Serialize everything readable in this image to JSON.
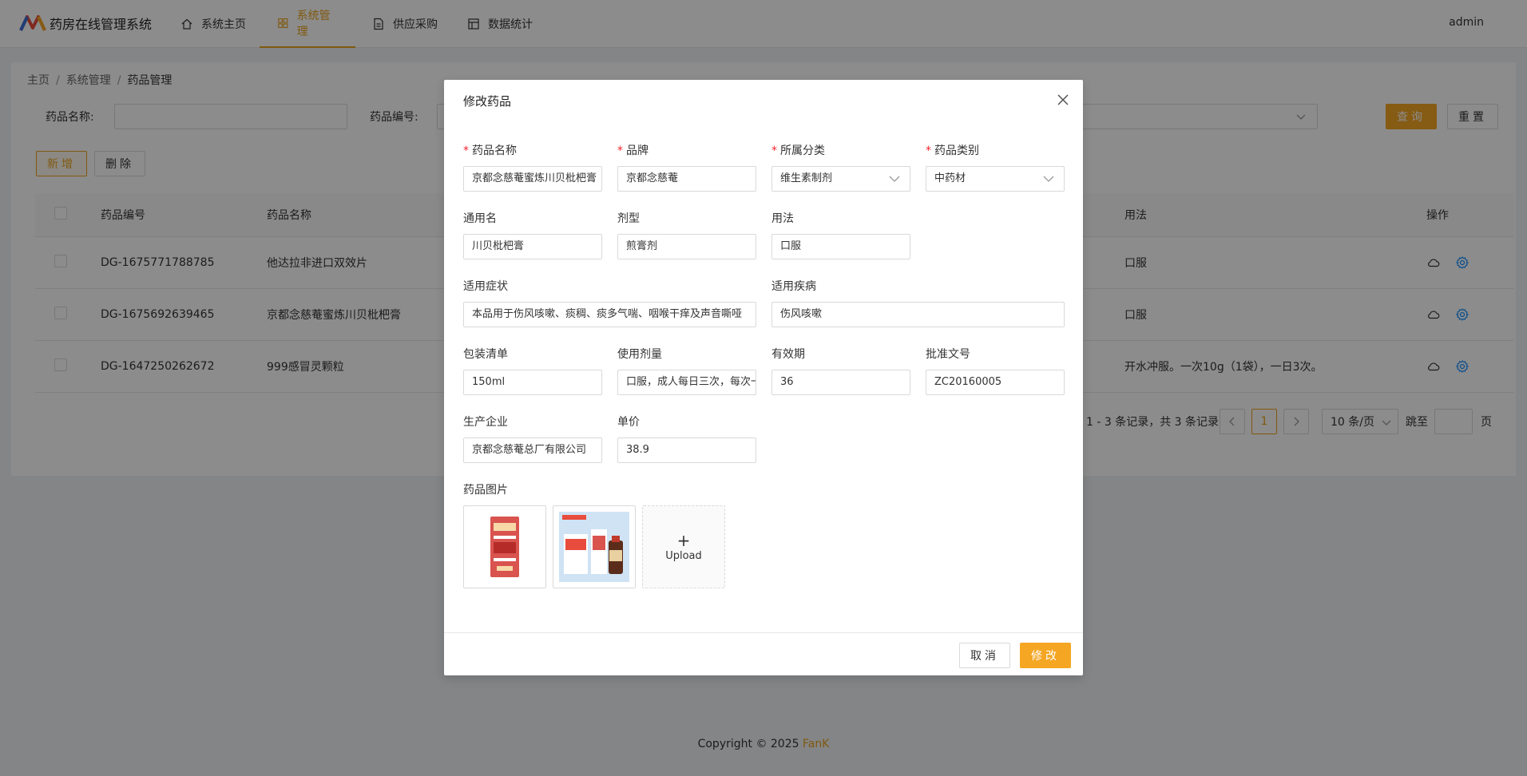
{
  "app": {
    "title": "药房在线管理系统",
    "user": "admin"
  },
  "nav": {
    "items": [
      {
        "label": "系统主页",
        "icon": "home-icon"
      },
      {
        "label": "系统管理",
        "icon": "grid-icon"
      },
      {
        "label": "供应采购",
        "icon": "document-icon"
      },
      {
        "label": "数据统计",
        "icon": "table-icon"
      }
    ],
    "active_index": 1
  },
  "breadcrumb": [
    "主页",
    "系统管理",
    "药品管理"
  ],
  "search": {
    "name_label": "药品名称:",
    "number_label": "药品编号:",
    "query_button": "查询",
    "reset_button": "重置"
  },
  "toolbar": {
    "add_button": "新增",
    "delete_button": "删除"
  },
  "table": {
    "columns": [
      "药品编号",
      "药品名称",
      "用法",
      "操作"
    ],
    "rows": [
      {
        "number": "DG-1675771788785",
        "name": "他达拉非进口双效片",
        "usage": "口服"
      },
      {
        "number": "DG-1675692639465",
        "name": "京都念慈菴蜜炼川贝枇杷膏",
        "usage": "口服"
      },
      {
        "number": "DG-1647250262672",
        "name": "999感冒灵颗粒",
        "usage": "开水冲服。一次10g（1袋），一日3次。"
      }
    ]
  },
  "pagination": {
    "summary": "1 - 3 条记录，共 3 条记录",
    "current_page": "1",
    "page_size": "10 条/页",
    "jump_label": "跳至",
    "page_unit": "页"
  },
  "footer": {
    "copyright_prefix": "Copyright © 2025 ",
    "brand": "FanK"
  },
  "modal": {
    "title": "修改药品",
    "fields": {
      "name": {
        "label": "药品名称",
        "value": "京都念慈菴蜜炼川贝枇杷膏"
      },
      "brand": {
        "label": "品牌",
        "value": "京都念慈菴"
      },
      "category": {
        "label": "所属分类",
        "value": "维生素制剂"
      },
      "type": {
        "label": "药品类别",
        "value": "中药材"
      },
      "generic_name": {
        "label": "通用名",
        "value": "川贝枇杷膏"
      },
      "dosage_form": {
        "label": "剂型",
        "value": "煎膏剂"
      },
      "usage": {
        "label": "用法",
        "value": "口服"
      },
      "symptoms": {
        "label": "适用症状",
        "value": "本品用于伤风咳嗽、痰稠、痰多气喘、咽喉干痒及声音嘶哑"
      },
      "disease": {
        "label": "适用疾病",
        "value": "伤风咳嗽"
      },
      "package": {
        "label": "包装清单",
        "value": "150ml"
      },
      "dosage": {
        "label": "使用剂量",
        "value": "口服，成人每日三次，每次一汤匙"
      },
      "validity": {
        "label": "有效期",
        "value": "36"
      },
      "approval": {
        "label": "批准文号",
        "value": "ZC20160005"
      },
      "manufacturer": {
        "label": "生产企业",
        "value": "京都念慈菴总厂有限公司"
      },
      "price": {
        "label": "单价",
        "value": "38.9"
      }
    },
    "images_label": "药品图片",
    "upload_label": "Upload",
    "cancel_button": "取消",
    "submit_button": "修改"
  },
  "colors": {
    "accent": "#f5a623",
    "accent_text": "#e9a21c",
    "required": "#f5222d",
    "gear": "#1890ff"
  }
}
